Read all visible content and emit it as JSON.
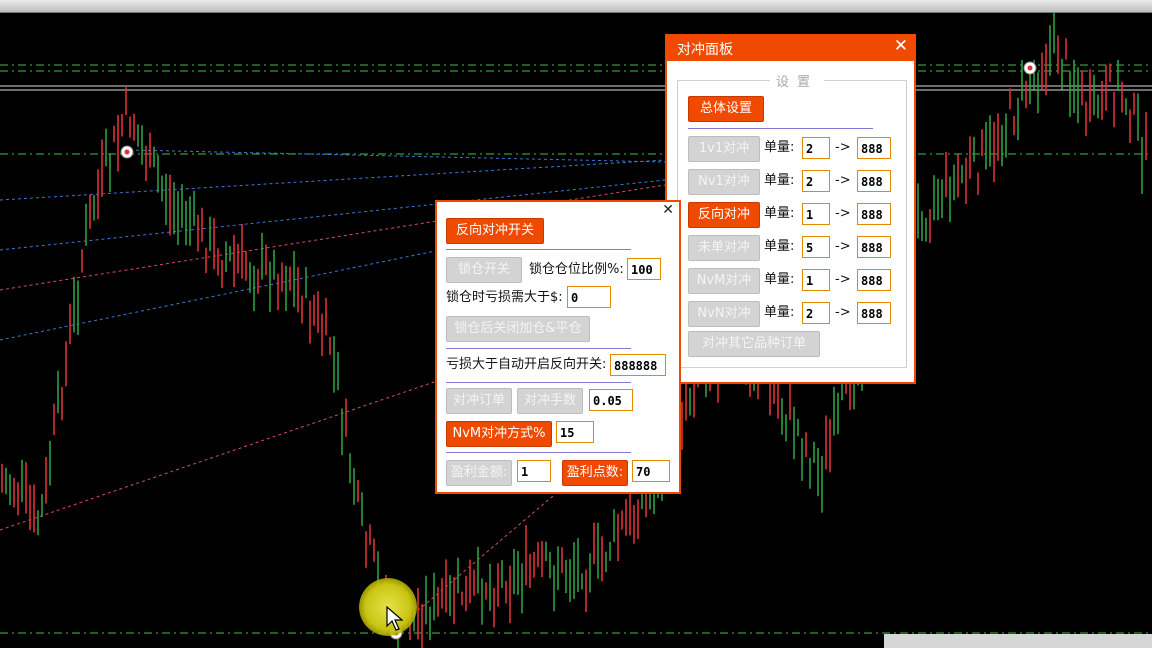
{
  "colors": {
    "accent": "#f04a00",
    "disabled": "#d3d3d3",
    "chart_bg": "#000000",
    "bull": "#2ea043",
    "bear": "#e0303a"
  },
  "hedge_panel": {
    "title": "对冲面板",
    "close_icon": "close-icon",
    "group_title": "设置",
    "overall_settings": "总体设置",
    "lot_label": "单量:",
    "arrow": "->",
    "rows": [
      {
        "button": "1v1对冲",
        "active": false,
        "lot": "2",
        "value": "888"
      },
      {
        "button": "Nv1对冲",
        "active": false,
        "lot": "2",
        "value": "888"
      },
      {
        "button": "反向对冲",
        "active": true,
        "lot": "1",
        "value": "888"
      },
      {
        "button": "未单对冲",
        "active": false,
        "lot": "5",
        "value": "888"
      },
      {
        "button": "NvM对冲",
        "active": false,
        "lot": "1",
        "value": "888"
      },
      {
        "button": "NvN对冲",
        "active": false,
        "lot": "2",
        "value": "888"
      }
    ],
    "hedge_other": "对冲其它品种订单"
  },
  "reverse_panel": {
    "close_icon": "close-icon",
    "toggle": "反向对冲开关",
    "lock_switch": "锁仓开关",
    "lock_ratio_label": "锁仓仓位比例%:",
    "lock_ratio_value": "100",
    "lock_loss_label": "锁仓时亏损需大于$:",
    "lock_loss_value": "0",
    "close_add_after_lock": "锁仓后关闭加仓&平仓",
    "auto_open_label": "亏损大于自动开启反向开关:",
    "auto_open_value": "888888",
    "hedge_order": "对冲订单",
    "hedge_lots": "对冲手数",
    "hedge_lots_value": "0.05",
    "nvm_mode": "NvM对冲方式%",
    "nvm_value": "15",
    "profit_amount": "盈利金额:",
    "profit_amount_value": "1",
    "profit_points": "盈利点数:",
    "profit_points_value": "70"
  }
}
